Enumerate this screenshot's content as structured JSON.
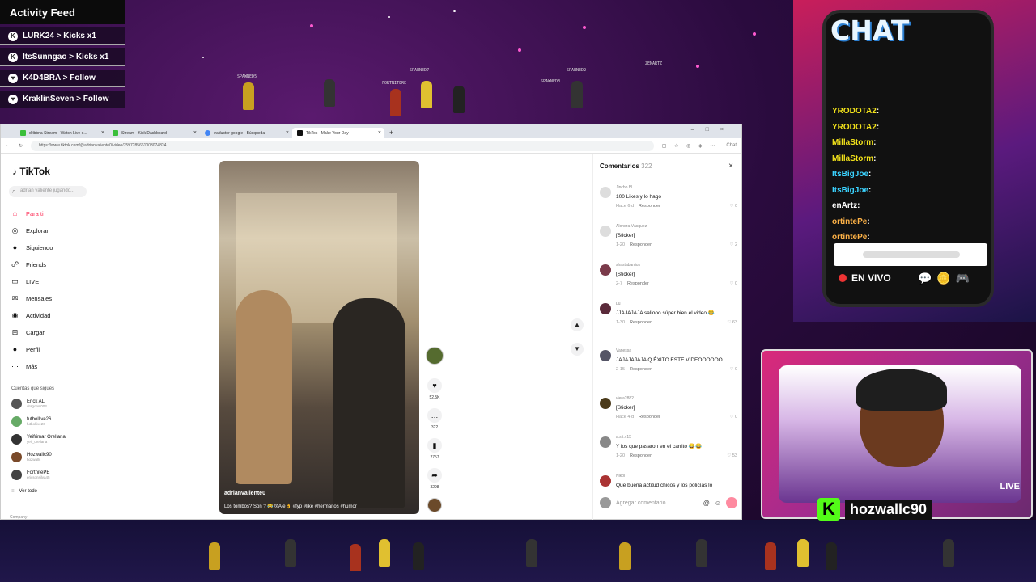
{
  "activity_feed": {
    "title": "Activity Feed",
    "items": [
      {
        "text": "LURK24 > Kicks x1",
        "icon": "kick-icon"
      },
      {
        "text": "ItsSunngao > Kicks x1",
        "icon": "kick-icon"
      },
      {
        "text": "K4D4BRA > Follow",
        "icon": "heart-icon"
      },
      {
        "text": "KraklinSeven > Follow",
        "icon": "heart-icon"
      }
    ]
  },
  "sprites": {
    "top_labels": [
      "SPAWNED5",
      "FORTNITERE",
      "SPAWNED7",
      "SPAWNED2",
      "ZENARTZ",
      "SPAWNED3"
    ]
  },
  "browser": {
    "tabs": [
      {
        "label": "dribbna Stream - Watch Live o..."
      },
      {
        "label": "Stream - Kick Dashboard"
      },
      {
        "label": "traductor google - Búsqueda"
      },
      {
        "label": "TikTok - Make Your Day"
      }
    ],
    "url": "https://www.tiktok.com/@adrianvaliente0/video/7597285661003074824",
    "chat_label": "Chat"
  },
  "tiktok": {
    "logo": "TikTok",
    "search_placeholder": "adrian valiente jugando...",
    "nav": [
      {
        "label": "Para ti",
        "icon": "home-icon",
        "active": true
      },
      {
        "label": "Explorar",
        "icon": "compass-icon"
      },
      {
        "label": "Siguiendo",
        "icon": "following-icon"
      },
      {
        "label": "Friends",
        "icon": "friends-icon"
      },
      {
        "label": "LIVE",
        "icon": "live-icon"
      },
      {
        "label": "Mensajes",
        "icon": "messages-icon"
      },
      {
        "label": "Actividad",
        "icon": "activity-icon"
      },
      {
        "label": "Cargar",
        "icon": "upload-icon"
      },
      {
        "label": "Perfil",
        "icon": "profile-icon"
      },
      {
        "label": "Más",
        "icon": "more-icon"
      }
    ],
    "following_title": "Cuentas que sigues",
    "following": [
      {
        "name": "Erick AL",
        "sub": "dragonsl003"
      },
      {
        "name": "futbollive26",
        "sub": "futbollive26"
      },
      {
        "name": "Yeifrimar Orellana",
        "sub": "yeii_orellana"
      },
      {
        "name": "Hozwallc90",
        "sub": "hozwallc"
      },
      {
        "name": "FortnitePE",
        "sub": "ericsonsilva45"
      }
    ],
    "see_all": "Ver todo",
    "company": "Company",
    "video": {
      "author": "adrianvaliente0",
      "caption": "Los tombos? Son ? 😂@Ale👌 #fyp #like #hermanos #humor",
      "stats": {
        "likes": "52.5K",
        "comments": "322",
        "saves": "2757",
        "shares": "3298"
      }
    },
    "comments_header": {
      "label": "Comentarios",
      "count": "322"
    },
    "comments": [
      {
        "user": "Jincho Bl",
        "text": "100 Likes y lo hago",
        "time": "Hace 6 d",
        "reply": "Responder",
        "likes": "0"
      },
      {
        "user": "Alondra Vásquez",
        "text": "[Sticker]",
        "time": "1-20",
        "reply": "Responder",
        "likes": "2"
      },
      {
        "user": "shastabarrios",
        "text": "[Sticker]",
        "time": "2-7",
        "reply": "Responder",
        "likes": "0"
      },
      {
        "user": "Lu",
        "text": "JJAJAJAJA saliooo súper bien el video 😂",
        "time": "1-30",
        "reply": "Responder",
        "likes": "63"
      },
      {
        "user": "Vanessa",
        "text": "JAJAJAJAJA Q ÉXITO ESTE VIDEOOOOOO",
        "time": "2-15",
        "reply": "Responder",
        "likes": "0"
      },
      {
        "user": "viera2882",
        "text": "[Sticker]",
        "time": "Hace 4 d",
        "reply": "Responder",
        "likes": "0"
      },
      {
        "user": "a.s.t.v15",
        "text": "Y los que pasaron en el carrito 😂😂",
        "time": "1-20",
        "reply": "Responder",
        "likes": "53"
      },
      {
        "user": "Nikol",
        "text": "Que buena actitud chicos y los policías lo",
        "time": "",
        "reply": "",
        "likes": ""
      }
    ],
    "comment_placeholder": "Agregar comentario..."
  },
  "chat": {
    "title": "CHAT",
    "lines": [
      {
        "user": "YRODOTA2",
        "msg": ""
      },
      {
        "user": "YRODOTA2",
        "msg": ""
      },
      {
        "user": "MillaStorm",
        "msg": ""
      },
      {
        "user": "MillaStorm",
        "msg": ""
      },
      {
        "user": "ItsBigJoe",
        "msg": ""
      },
      {
        "user": "ItsBigJoe",
        "msg": ""
      },
      {
        "user": "enArtz",
        "msg": ""
      },
      {
        "user": "ortintePe",
        "msg": ""
      },
      {
        "user": "ortintePe",
        "msg": ""
      }
    ],
    "live_label": "EN VIVO"
  },
  "webcam": {
    "live_label": "LIVE",
    "username": "hozwallc90"
  },
  "colors": {
    "tiktok_accent": "#fe2c55",
    "kick_green": "#53fc18"
  }
}
